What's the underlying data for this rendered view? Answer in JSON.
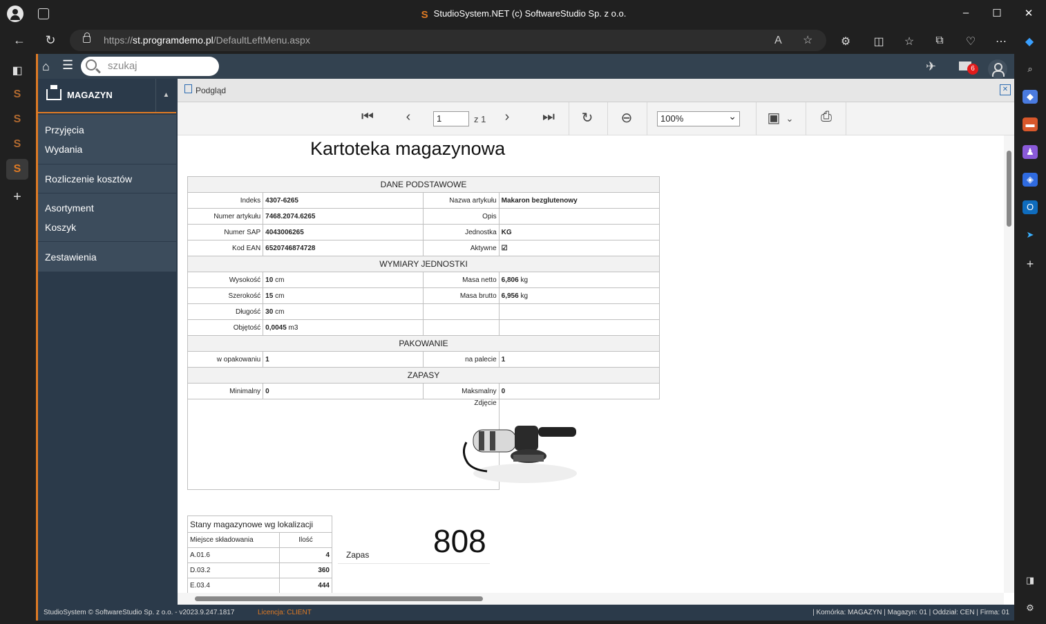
{
  "browser": {
    "title": "StudioSystem.NET (c) SoftwareStudio Sp. z o.o.",
    "url_prefix": "https://",
    "url_domain": "st.programdemo.pl",
    "url_path": "/DefaultLeftMenu.aspx"
  },
  "app": {
    "search_placeholder": "szukaj",
    "mail_badge": "6",
    "module": "MAGAZYN",
    "menu_groups": [
      [
        "Przyjęcia",
        "Wydania"
      ],
      [
        "Rozliczenie kosztów"
      ],
      [
        "Asortyment",
        "Koszyk"
      ],
      [
        "Zestawienia"
      ]
    ],
    "footer_left": "StudioSystem © SoftwareStudio Sp. z o.o. - v2023.9.247.1817",
    "footer_license": "Licencja: CLIENT",
    "footer_right": "| Komórka: MAGAZYN | Magazyn: 01 | Oddział: CEN | Firma: 01"
  },
  "viewer": {
    "panel_title": "Podgląd",
    "page_current": "1",
    "page_of": "z 1",
    "zoom": "100%"
  },
  "report": {
    "title": "Kartoteka magazynowa",
    "sec_basic": "DANE PODSTAWOWE",
    "sec_dims": "WYMIARY JEDNOSTKI",
    "sec_pack": "PAKOWANIE",
    "sec_stock": "ZAPASY",
    "indeks_l": "Indeks",
    "indeks": "4307-6265",
    "nazwa_l": "Nazwa artykułu",
    "nazwa": "Makaron bezglutenowy",
    "numer_l": "Numer artykułu",
    "numer": "7468.2074.6265",
    "opis_l": "Opis",
    "sap_l": "Numer SAP",
    "sap": "4043006265",
    "jedn_l": "Jednostka",
    "jedn": "KG",
    "ean_l": "Kod EAN",
    "ean": "6520746874728",
    "aktywne_l": "Aktywne",
    "aktywne": "☑",
    "wys_l": "Wysokość",
    "wys": "10",
    "wys_u": "cm",
    "netto_l": "Masa netto",
    "netto": "6,806",
    "netto_u": "kg",
    "szer_l": "Szerokość",
    "szer": "15",
    "szer_u": "cm",
    "brutto_l": "Masa brutto",
    "brutto": "6,956",
    "brutto_u": "kg",
    "dl_l": "Długość",
    "dl": "30",
    "dl_u": "cm",
    "obj_l": "Objętość",
    "obj": "0,0045",
    "obj_u": "m3",
    "wopak_l": "w opakowaniu",
    "wopak": "1",
    "napal_l": "na palecie",
    "napal": "1",
    "min_l": "Minimalny",
    "min": "0",
    "max_l": "Maksmalny",
    "max": "0",
    "zdjecie_l": "Zdjęcie",
    "stock_title": "Stany magazynowe wg lokalizacji",
    "stock_col1": "Miejsce składowania",
    "stock_col2": "Ilość",
    "stock_rows": [
      {
        "loc": "A.01.6",
        "qty": "4"
      },
      {
        "loc": "D.03.2",
        "qty": "360"
      },
      {
        "loc": "E.03.4",
        "qty": "444"
      }
    ],
    "zapas_label": "Zapas",
    "zapas_value": "808"
  }
}
